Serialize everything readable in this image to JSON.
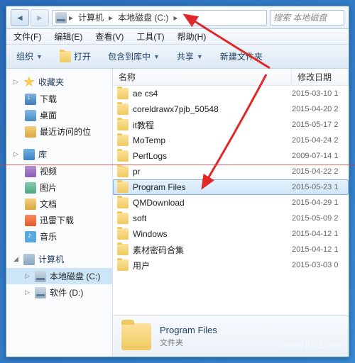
{
  "breadcrumb": {
    "seg1": "计算机",
    "seg2": "本地磁盘 (C:)"
  },
  "search": {
    "placeholder": "搜索 本地磁盘"
  },
  "menu": {
    "file": "文件(F)",
    "edit": "编辑(E)",
    "view": "查看(V)",
    "tools": "工具(T)",
    "help": "帮助(H)"
  },
  "toolbar": {
    "org": "组织",
    "open": "打开",
    "include": "包含到库中",
    "share": "共享",
    "newfolder": "新建文件夹"
  },
  "sidebar": {
    "fav": {
      "head": "收藏夹",
      "items": [
        "下载",
        "桌面",
        "最近访问的位"
      ]
    },
    "lib": {
      "head": "库",
      "items": [
        "视频",
        "图片",
        "文档",
        "迅雷下载",
        "音乐"
      ]
    },
    "pc": {
      "head": "计算机",
      "items": [
        "本地磁盘 (C:)",
        "软件 (D:)"
      ]
    }
  },
  "columns": {
    "name": "名称",
    "date": "修改日期"
  },
  "files": [
    {
      "n": "ae cs4",
      "d": "2015-03-10 1"
    },
    {
      "n": "coreldrawx7pjb_50548",
      "d": "2015-04-20 2"
    },
    {
      "n": "it教程",
      "d": "2015-05-17 2"
    },
    {
      "n": "MoTemp",
      "d": "2015-04-24 2"
    },
    {
      "n": "PerfLogs",
      "d": "2009-07-14 1"
    },
    {
      "n": "pr",
      "d": "2015-04-22 2"
    },
    {
      "n": "Program Files",
      "d": "2015-05-23 1",
      "sel": true
    },
    {
      "n": "QMDownload",
      "d": "2015-04-29 1"
    },
    {
      "n": "soft",
      "d": "2015-05-09 2"
    },
    {
      "n": "Windows",
      "d": "2015-04-12 1"
    },
    {
      "n": "素材密码合集",
      "d": "2015-04-12 1"
    },
    {
      "n": "用户",
      "d": "2015-03-03 0"
    }
  ],
  "details": {
    "name": "Program Files",
    "type": "文件夹"
  },
  "watermark": "www.jb51.net"
}
